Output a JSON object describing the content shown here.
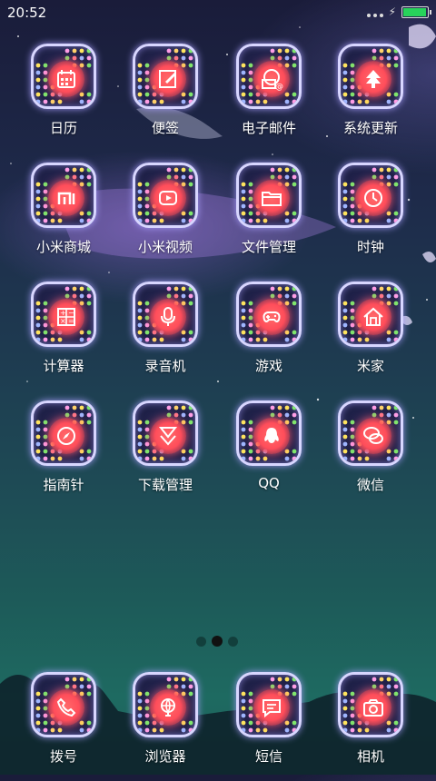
{
  "status": {
    "time": "20:52",
    "battery_color": "#28d35b",
    "battery_level": 0.95
  },
  "accent_colors": {
    "icon_border": "#d8d6ff",
    "glow_center": "#ff4d5a"
  },
  "apps": [
    {
      "label": "日历",
      "icon": "calendar-icon"
    },
    {
      "label": "便签",
      "icon": "note-pencil-icon"
    },
    {
      "label": "电子邮件",
      "icon": "email-at-icon"
    },
    {
      "label": "系统更新",
      "icon": "update-arrow-icon"
    },
    {
      "label": "小米商城",
      "icon": "mi-store-icon"
    },
    {
      "label": "小米视频",
      "icon": "video-play-icon"
    },
    {
      "label": "文件管理",
      "icon": "folder-icon"
    },
    {
      "label": "时钟",
      "icon": "clock-icon"
    },
    {
      "label": "计算器",
      "icon": "calculator-icon"
    },
    {
      "label": "录音机",
      "icon": "microphone-icon"
    },
    {
      "label": "游戏",
      "icon": "gamepad-icon"
    },
    {
      "label": "米家",
      "icon": "home-icon"
    },
    {
      "label": "指南针",
      "icon": "compass-icon"
    },
    {
      "label": "下载管理",
      "icon": "download-icon"
    },
    {
      "label": "QQ",
      "icon": "qq-penguin-icon"
    },
    {
      "label": "微信",
      "icon": "wechat-icon"
    }
  ],
  "pager": {
    "pages": 3,
    "active": 1
  },
  "dock": [
    {
      "label": "拨号",
      "icon": "phone-icon"
    },
    {
      "label": "浏览器",
      "icon": "browser-globe-icon"
    },
    {
      "label": "短信",
      "icon": "message-icon"
    },
    {
      "label": "相机",
      "icon": "camera-icon"
    }
  ]
}
